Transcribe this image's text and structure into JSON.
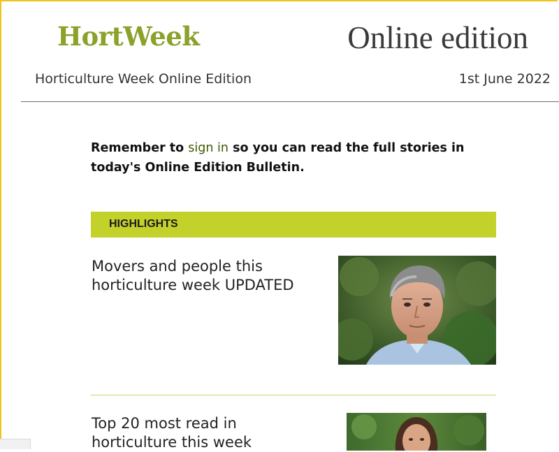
{
  "header": {
    "brand": "HortWeek",
    "edition_title": "Online edition",
    "publication_name": "Horticulture Week Online Edition",
    "date": "1st June 2022"
  },
  "reminder": {
    "text_before": "Remember to ",
    "link_text": "sign in",
    "text_after": " so you can read the full stories in today's Online Edition Bulletin."
  },
  "highlights": {
    "label": "HIGHLIGHTS"
  },
  "stories": [
    {
      "title": "Movers and people this horticulture week UPDATED",
      "image_icon": "man-portrait-photo"
    },
    {
      "title": "Top 20 most read in horticulture this week",
      "image_icon": "woman-portrait-photo"
    }
  ],
  "colors": {
    "brand_green": "#8aa12a",
    "highlight_bar": "#c3d22b",
    "frame_border": "#f0c419",
    "link": "#3d5a00"
  }
}
